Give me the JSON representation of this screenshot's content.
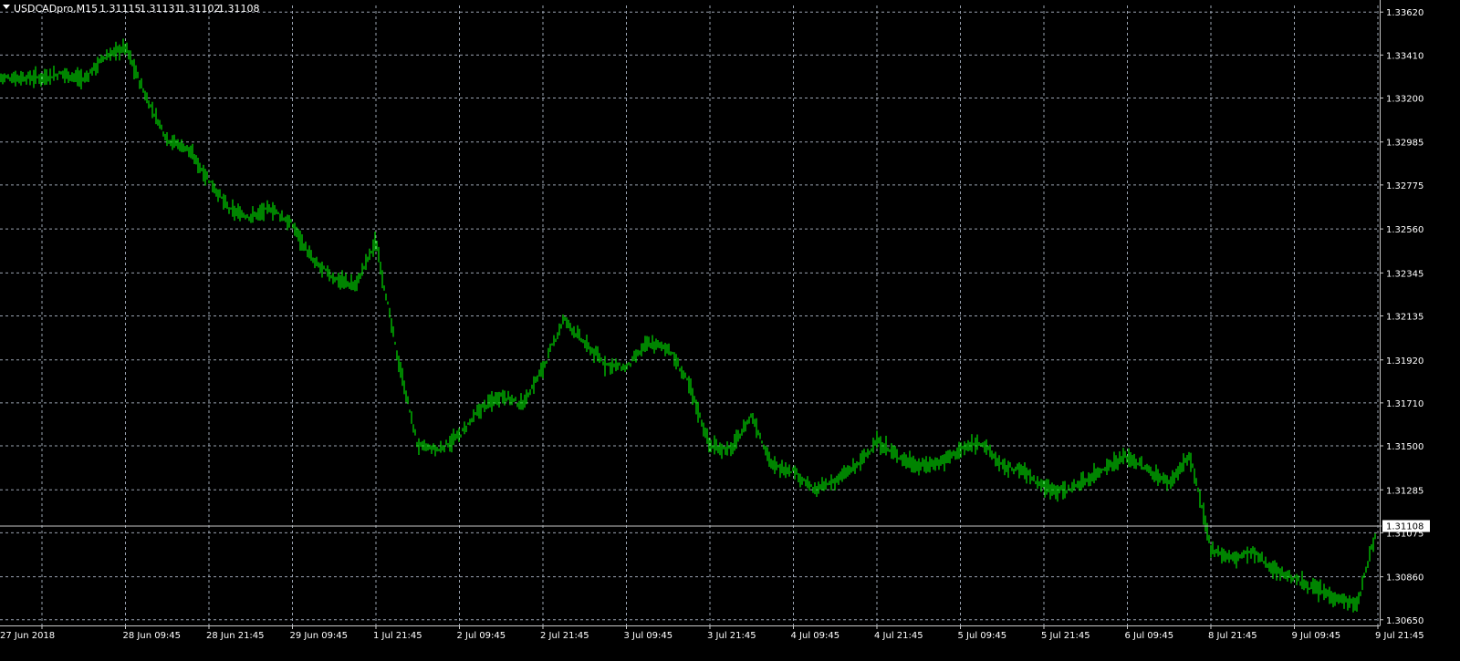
{
  "header": {
    "symbol": "USDCADpro,M15",
    "open": "1.31115",
    "high": "1.31131",
    "low": "1.31102",
    "close": "1.31108"
  },
  "current_price_label": "1.31108",
  "colors": {
    "background": "#000000",
    "grid": "#9aa3b1",
    "axis": "#c8c8c8",
    "text": "#ffffff",
    "bars": "#00dd00",
    "price_line": "#c8c8c8",
    "price_label_bg": "#ffffff",
    "price_label_text": "#000000"
  },
  "chart_data": {
    "type": "line",
    "style": "ohlc-bars",
    "timeframe": "M15",
    "grid": true,
    "y_ticks": [
      "1.33620",
      "1.33410",
      "1.33200",
      "1.32985",
      "1.32775",
      "1.32560",
      "1.32345",
      "1.32135",
      "1.31920",
      "1.31710",
      "1.31500",
      "1.31285",
      "1.31075",
      "1.30860",
      "1.30650"
    ],
    "y_tick_values": [
      1.3362,
      1.3341,
      1.332,
      1.32985,
      1.32775,
      1.3256,
      1.32345,
      1.32135,
      1.3192,
      1.3171,
      1.315,
      1.31285,
      1.31075,
      1.3086,
      1.3065
    ],
    "x_ticks": [
      "27 Jun 2018",
      "28 Jun 09:45",
      "28 Jun 21:45",
      "29 Jun 09:45",
      "1 Jul 21:45",
      "2 Jul 09:45",
      "2 Jul 21:45",
      "3 Jul 09:45",
      "3 Jul 21:45",
      "4 Jul 09:45",
      "4 Jul 21:45",
      "5 Jul 09:45",
      "5 Jul 21:45",
      "6 Jul 09:45",
      "8 Jul 21:45",
      "9 Jul 09:45",
      "9 Jul 21:45"
    ],
    "ylim": [
      1.3062,
      1.3365
    ],
    "current_price": 1.31108,
    "series": [
      {
        "name": "USDCADpro,M15",
        "x": [
          0,
          0.25,
          0.5,
          0.75,
          1.0,
          1.25,
          1.5,
          1.75,
          2.0,
          2.25,
          2.5,
          2.75,
          3.0,
          3.25,
          3.5,
          3.75,
          4.0,
          4.25,
          4.5,
          4.75,
          5.0,
          5.25,
          5.5,
          5.75,
          6.0,
          6.25,
          6.5,
          6.75,
          7.0,
          7.25,
          7.5,
          7.75,
          8.0,
          8.25,
          8.5,
          8.75,
          9.0,
          9.25,
          9.5,
          9.75,
          10.0,
          10.25,
          10.5,
          10.75,
          11.0,
          11.25,
          11.5,
          11.75,
          12.0,
          12.25,
          12.5,
          12.75,
          13.0,
          13.25,
          13.5,
          13.75,
          14.0,
          14.25,
          14.5,
          14.75,
          15.0,
          15.25,
          15.5,
          15.75,
          16.0,
          16.25,
          16.5
        ],
        "y": [
          1.333,
          1.3332,
          1.3329,
          1.334,
          1.3345,
          1.332,
          1.33,
          1.3295,
          1.328,
          1.3265,
          1.3262,
          1.3266,
          1.3258,
          1.324,
          1.3232,
          1.3228,
          1.325,
          1.3195,
          1.315,
          1.3148,
          1.3155,
          1.3168,
          1.3175,
          1.317,
          1.3188,
          1.3212,
          1.32,
          1.319,
          1.3188,
          1.32,
          1.3198,
          1.318,
          1.315,
          1.3148,
          1.3165,
          1.314,
          1.3138,
          1.3128,
          1.3133,
          1.314,
          1.3152,
          1.3145,
          1.314,
          1.3142,
          1.3148,
          1.3152,
          1.314,
          1.3138,
          1.313,
          1.3128,
          1.3133,
          1.314,
          1.3145,
          1.3138,
          1.3132,
          1.3145,
          1.31,
          1.3095,
          1.3098,
          1.309,
          1.3085,
          1.308,
          1.3076,
          1.3072,
          1.3112,
          1.3115,
          1.3111
        ]
      }
    ]
  }
}
